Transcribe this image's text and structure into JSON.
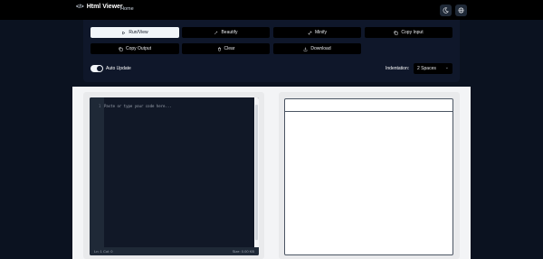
{
  "nav": {
    "brand": "Html Viewer",
    "home_link": "Home",
    "icons": [
      "code-icon",
      "moon-icon",
      "globe-icon"
    ]
  },
  "toolbar": {
    "run_view": "Run/View",
    "beautify": "Beautify",
    "minify": "Minify",
    "copy_input": "Copy Input",
    "copy_output": "Copy Output",
    "clear": "Clear",
    "download": "Download",
    "auto_update_label": "Auto Update",
    "auto_update_on": true,
    "indentation_label": "Indentation:",
    "indentation_value": "2 Spaces"
  },
  "editor": {
    "line_number": "1",
    "placeholder": "Paste or type your code here...",
    "cursor_status": "Ln: 1 Col: 0",
    "size_status": "Size: 0.00 KB"
  },
  "colors": {
    "nav_bg": "#000000",
    "page_bg": "#0b1220",
    "toolbar_bg": "#0f172a",
    "primary_button_bg": "#f1f5f9",
    "editor_bg": "#111827"
  }
}
